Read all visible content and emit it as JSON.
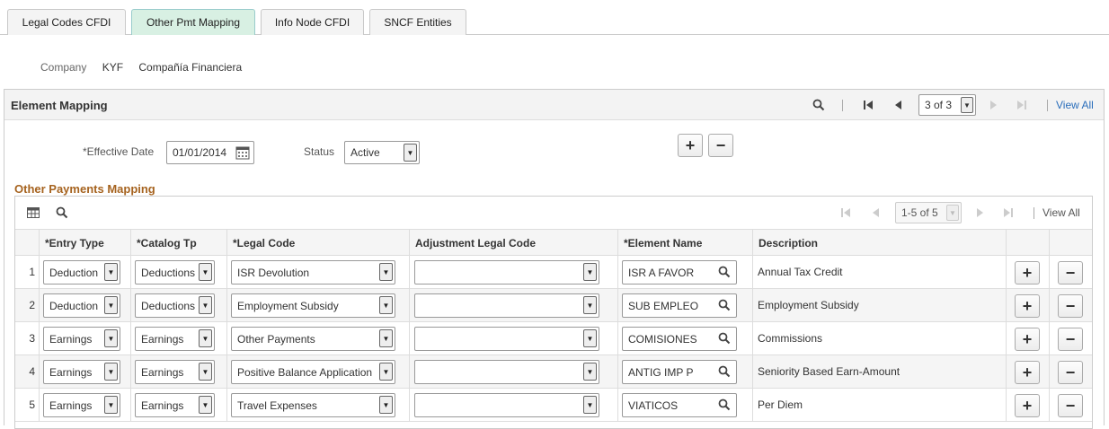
{
  "tabs": [
    {
      "label": "Legal Codes CFDI"
    },
    {
      "label": "Other Pmt Mapping"
    },
    {
      "label": "Info Node CFDI"
    },
    {
      "label": "SNCF Entities"
    }
  ],
  "company": {
    "label": "Company",
    "code": "KYF",
    "name": "Compañía Financiera"
  },
  "element_mapping": {
    "title": "Element Mapping",
    "pager": "3 of 3",
    "view_all": "View All",
    "effective_date_label": "*Effective Date",
    "effective_date": "01/01/2014",
    "status_label": "Status",
    "status": "Active",
    "add_symbol": "+",
    "remove_symbol": "−"
  },
  "other_payments": {
    "title": "Other Payments Mapping",
    "pager": "1-5 of 5",
    "view_all": "View All",
    "columns": {
      "entry_type": "*Entry Type",
      "catalog_tp": "*Catalog Tp",
      "legal_code": "*Legal Code",
      "adjustment": "Adjustment Legal Code",
      "element_name": "*Element Name",
      "description": "Description"
    },
    "rows": [
      {
        "num": "1",
        "entry_type": "Deduction",
        "catalog_tp": "Deductions",
        "legal_code": "ISR Devolution",
        "adjustment": "",
        "element_name": "ISR A FAVOR",
        "description": "Annual Tax Credit"
      },
      {
        "num": "2",
        "entry_type": "Deduction",
        "catalog_tp": "Deductions",
        "legal_code": "Employment Subsidy",
        "adjustment": "",
        "element_name": "SUB EMPLEO",
        "description": "Employment Subsidy"
      },
      {
        "num": "3",
        "entry_type": "Earnings",
        "catalog_tp": "Earnings",
        "legal_code": "Other Payments",
        "adjustment": "",
        "element_name": "COMISIONES",
        "description": "Commissions"
      },
      {
        "num": "4",
        "entry_type": "Earnings",
        "catalog_tp": "Earnings",
        "legal_code": "Positive Balance Application",
        "adjustment": "",
        "element_name": "ANTIG IMP P",
        "description": "Seniority Based Earn-Amount"
      },
      {
        "num": "5",
        "entry_type": "Earnings",
        "catalog_tp": "Earnings",
        "legal_code": "Travel Expenses",
        "adjustment": "",
        "element_name": "VIATICOS",
        "description": "Per Diem"
      }
    ]
  },
  "icons": {
    "search": "magnifier-icon",
    "first": "first-page-icon",
    "prev": "previous-page-icon",
    "next": "next-page-icon",
    "last": "last-page-icon",
    "calendar": "calendar-icon",
    "grid_personalize": "grid-personalize-icon"
  }
}
